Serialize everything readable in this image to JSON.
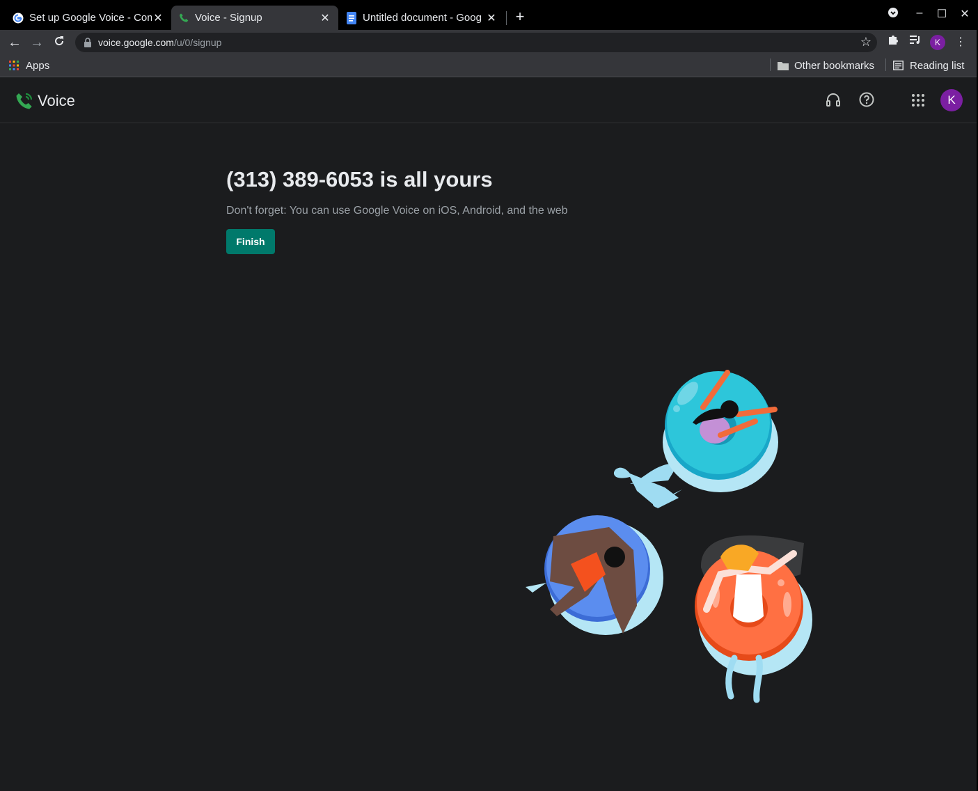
{
  "browser": {
    "tabs": [
      {
        "title": "Set up Google Voice - Com",
        "icon": "google-g-icon"
      },
      {
        "title": "Voice - Signup",
        "icon": "voice-phone-icon"
      },
      {
        "title": "Untitled document - Goog",
        "icon": "docs-icon"
      }
    ],
    "address": {
      "host": "voice.google.com",
      "path": "/u/0/signup"
    },
    "profile_initial": "K",
    "bookmarks": {
      "apps_label": "Apps",
      "other_label": "Other bookmarks",
      "reading_label": "Reading list"
    }
  },
  "app": {
    "name": "Voice",
    "avatar_initial": "K"
  },
  "main": {
    "headline": "(313) 389-6053 is all yours",
    "subtext": "Don't forget: You can use Google Voice on iOS, Android, and the web",
    "finish_label": "Finish"
  },
  "colors": {
    "accent": "#00796b",
    "avatar": "#7b1fa2",
    "background": "#1b1c1e"
  }
}
